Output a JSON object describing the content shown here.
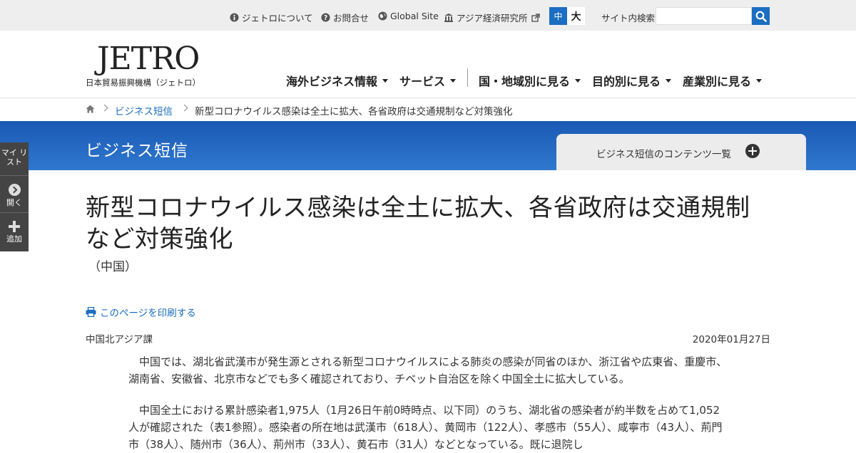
{
  "utility": {
    "about_label": "ジェトロについて",
    "contact_label": "お問合せ",
    "global_label": "Global Site",
    "ide_label": "アジア経済研究所",
    "font_mid": "中",
    "font_big": "大",
    "search_label": "サイト内検索",
    "search_value": ""
  },
  "header": {
    "logo_text": "JETRO",
    "logo_sub": "日本貿易振興機構（ジェトロ）",
    "nav": [
      {
        "label": "海外ビジネス情報"
      },
      {
        "label": "サービス"
      },
      {
        "label": "国・地域別に見る"
      },
      {
        "label": "目的別に見る"
      },
      {
        "label": "産業別に見る"
      }
    ]
  },
  "breadcrumb": {
    "items": [
      {
        "label": "ビジネス短信"
      },
      {
        "label": "新型コロナウイルス感染は全土に拡大、各省政府は交通規制など対策強化"
      }
    ]
  },
  "banner": {
    "title": "ビジネス短信",
    "tab_label": "ビジネス短信のコンテンツ一覧"
  },
  "side_panel": {
    "mylist": "マイ リスト",
    "open": "開く",
    "add": "追加"
  },
  "article": {
    "title": "新型コロナウイルス感染は全土に拡大、各省政府は交通規制など対策強化",
    "region": "（中国）",
    "print_label": "このページを印刷する",
    "department": "中国北アジア課",
    "date": "2020年01月27日",
    "paragraphs": [
      "中国では、湖北省武漢市が発生源とされる新型コロナウイルスによる肺炎の感染が同省のほか、浙江省や広東省、重慶市、湖南省、安徽省、北京市などでも多く確認されており、チベット自治区を除く中国全土に拡大している。",
      "中国全土における累計感染者1,975人（1月26日午前0時時点、以下同）のうち、湖北省の感染者が約半数を占めて1,052人が確認された（表1参照）。感染者の所在地は武漢市（618人）、黄岡市（122人）、孝感市（55人）、咸寧市（43人）、荊門市（38人）、随州市（36人）、荊州市（33人）、黄石市（31人）などとなっている。既に退院し"
    ]
  },
  "colors": {
    "accent": "#1b6ec2",
    "banner_top": "#1a59b4",
    "banner_bottom": "#2f78cf",
    "utility_bg": "#eeeeee",
    "side_bg": "#444444"
  }
}
